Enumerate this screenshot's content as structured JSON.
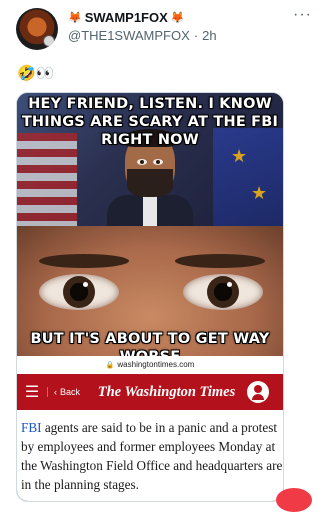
{
  "author": {
    "name": "SWAMP1FOX",
    "name_prefix_icon": "🦊",
    "name_suffix_icon": "🦊",
    "handle": "@THE1SWAMPFOX",
    "separator": "·",
    "time": "2h"
  },
  "more_label": "···",
  "tweet_text": "🤣👀",
  "meme": {
    "top_text": "HEY FRIEND, LISTEN. I KNOW THINGS ARE SCARY AT THE FBI RIGHT NOW",
    "bottom_text": "BUT IT'S ABOUT TO GET WAY WORSE"
  },
  "website": {
    "url": "washingtontimes.com",
    "back_label": "Back",
    "logo_text": "The Washington Times",
    "article_link": "FBI",
    "article_text": " agents are said to be in a panic and a protest by employees and former employees Monday at the Washington Field Office and headquarters are in the planning stages."
  }
}
